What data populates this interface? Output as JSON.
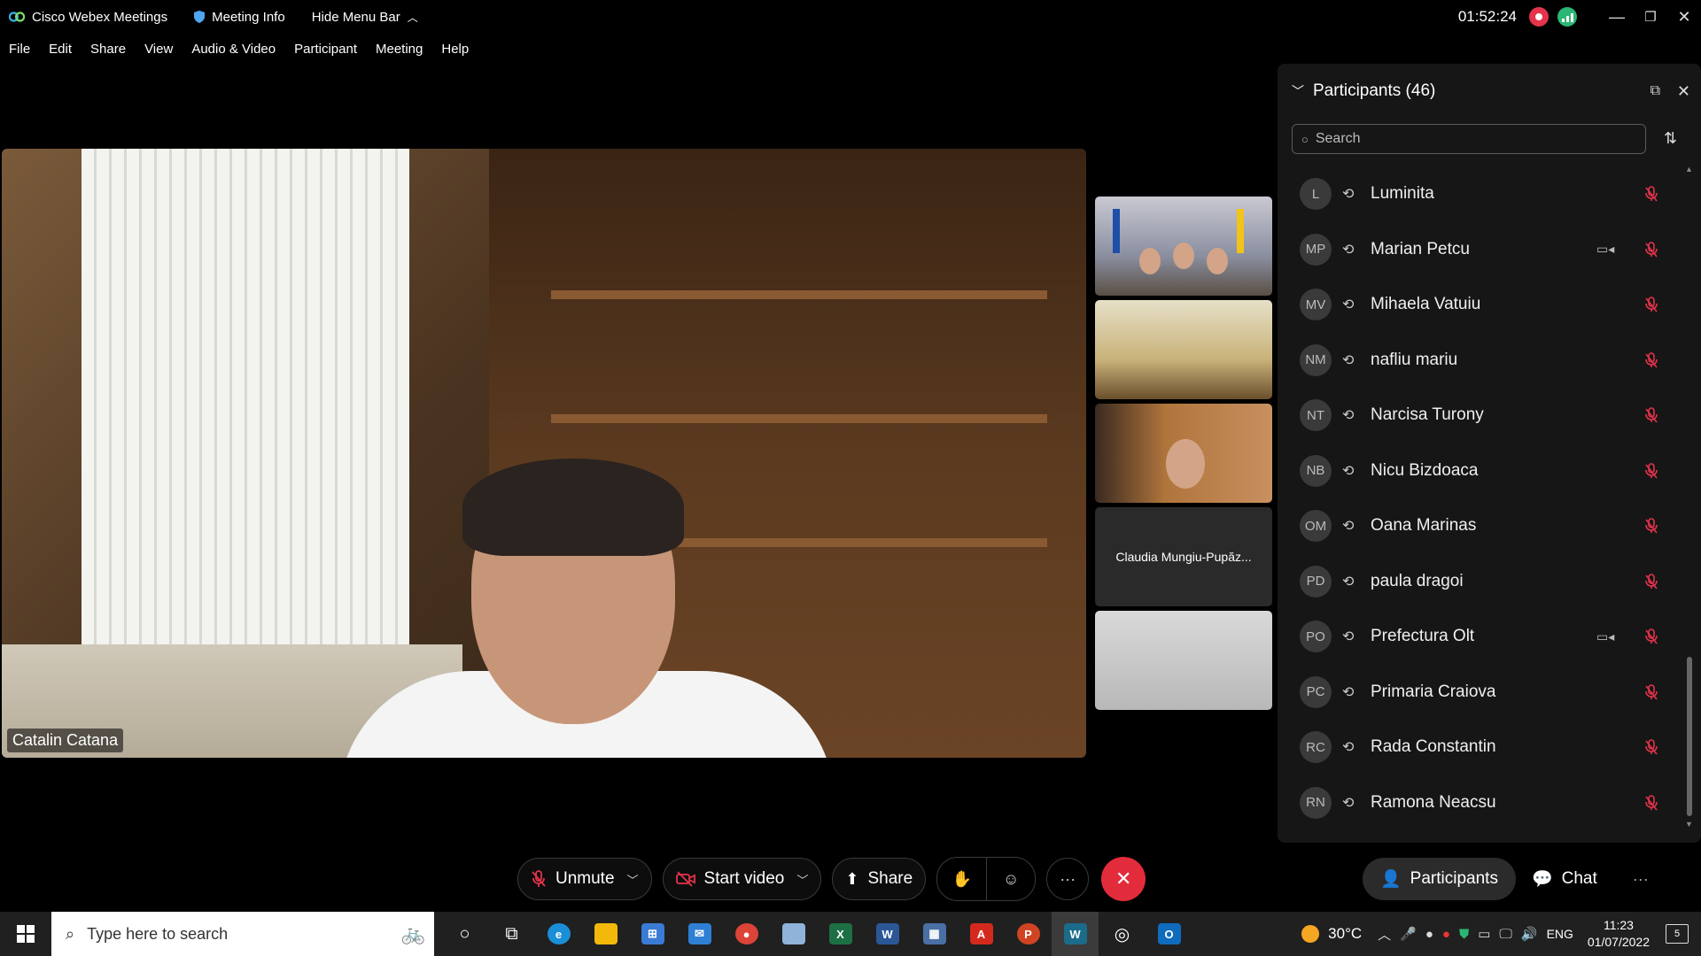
{
  "titlebar": {
    "app_name": "Cisco Webex Meetings",
    "meeting_info": "Meeting Info",
    "hide_menu_bar": "Hide Menu Bar",
    "timer": "01:52:24"
  },
  "menu": [
    "File",
    "Edit",
    "Share",
    "View",
    "Audio & Video",
    "Participant",
    "Meeting",
    "Help"
  ],
  "main_video": {
    "name": "Catalin Catana"
  },
  "thumbnails": [
    {
      "name": ""
    },
    {
      "name": ""
    },
    {
      "name": ""
    },
    {
      "name": "Claudia Mungiu-Pupăz..."
    },
    {
      "name": ""
    }
  ],
  "participants_panel": {
    "title": "Participants (46)",
    "search_placeholder": "Search",
    "items": [
      {
        "initials": "L",
        "name": "Luminita",
        "video": false
      },
      {
        "initials": "MP",
        "name": "Marian Petcu",
        "video": true
      },
      {
        "initials": "MV",
        "name": "Mihaela Vatuiu",
        "video": false
      },
      {
        "initials": "NM",
        "name": "nafliu mariu",
        "video": false
      },
      {
        "initials": "NT",
        "name": "Narcisa Turony",
        "video": false
      },
      {
        "initials": "NB",
        "name": "Nicu Bizdoaca",
        "video": false
      },
      {
        "initials": "OM",
        "name": "Oana Marinas",
        "video": false
      },
      {
        "initials": "PD",
        "name": "paula dragoi",
        "video": false
      },
      {
        "initials": "PO",
        "name": "Prefectura Olt",
        "video": true
      },
      {
        "initials": "PC",
        "name": "Primaria Craiova",
        "video": false
      },
      {
        "initials": "RC",
        "name": "Rada Constantin",
        "video": false
      },
      {
        "initials": "RN",
        "name": "Ramona Neacsu",
        "video": false
      }
    ]
  },
  "controls": {
    "unmute": "Unmute",
    "start_video": "Start video",
    "share": "Share",
    "participants": "Participants",
    "chat": "Chat"
  },
  "taskbar": {
    "search_placeholder": "Type here to search",
    "temperature": "30°C",
    "language": "ENG",
    "time": "11:23",
    "date": "01/07/2022",
    "notifications": "5"
  },
  "colors": {
    "end_call": "#e32c3b",
    "mic_off": "#e5334b",
    "recording": "#e5334b",
    "panel_bg": "#161616"
  }
}
